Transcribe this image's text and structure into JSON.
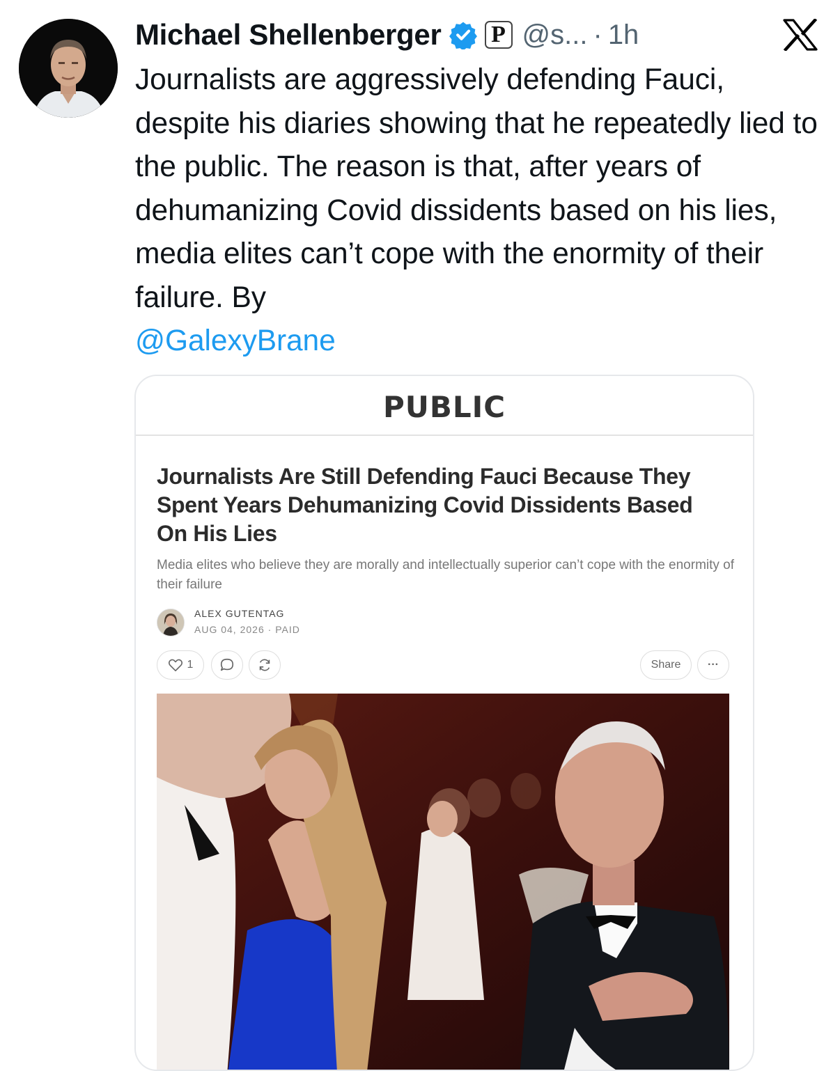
{
  "tweet": {
    "author_name": "Michael Shellenberger",
    "affiliate_badge": "P",
    "handle": "@s...",
    "separator": "·",
    "time": "1h",
    "text": "Journalists are aggressively defending Fauci, despite his diaries showing that he repeatedly lied to the public. The reason is that, after years of dehumanizing Covid dissidents based on his lies, media elites can’t cope with the enormity of their failure. By",
    "mention": "@GalexyBrane",
    "icons": {
      "verified": "verified-badge-icon",
      "platform": "x-logo-icon"
    },
    "colors": {
      "verified": "#1d9bf0",
      "mention": "#1d9bf0",
      "secondary_text": "#536471"
    }
  },
  "card": {
    "publication": "PUBLIC",
    "article_title": "Journalists Are Still Defending Fauci Because They Spent Years Dehumanizing Covid Dissidents Based On His Lies",
    "article_subtitle": "Media elites who believe they are morally and intellectually superior can’t cope with the enormity of their failure",
    "author": "ALEX GUTENTAG",
    "date": "AUG 04, 2026",
    "meta_separator": "·",
    "access": "PAID",
    "like_count": "1",
    "share_label": "Share",
    "more_label": "···",
    "icons": [
      "heart-icon",
      "comment-icon",
      "restack-icon",
      "more-icon"
    ]
  }
}
